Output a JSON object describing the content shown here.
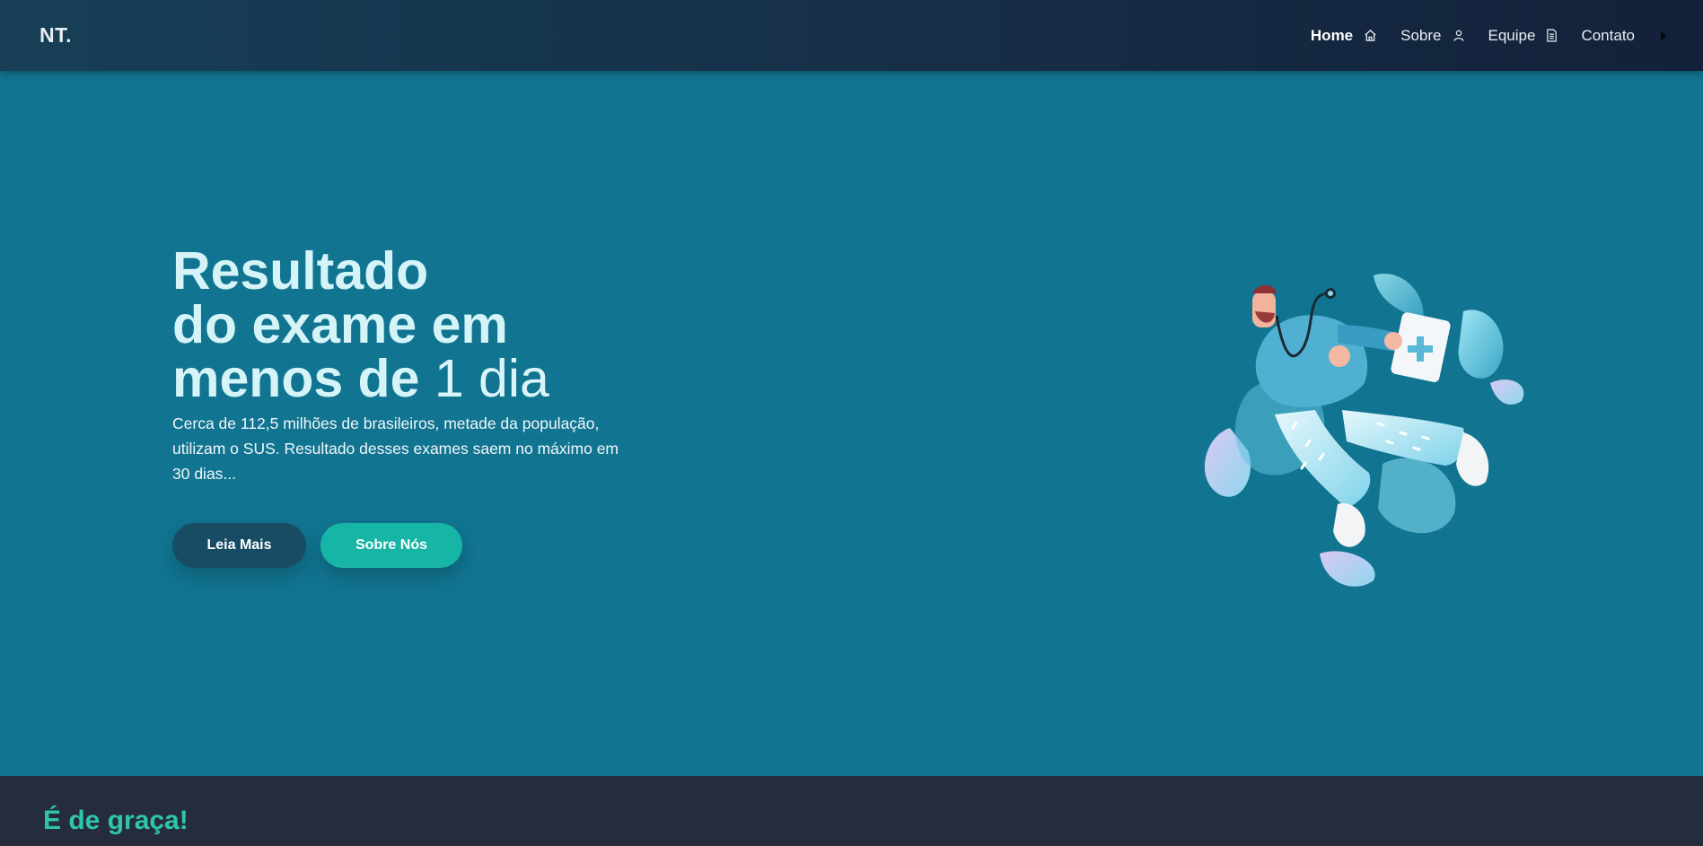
{
  "navbar": {
    "logo": "NT.",
    "items": [
      {
        "label": "Home",
        "icon": "home-icon",
        "active": true
      },
      {
        "label": "Sobre",
        "icon": "user-icon",
        "active": false
      },
      {
        "label": "Equipe",
        "icon": "document-icon",
        "active": false
      },
      {
        "label": "Contato",
        "icon": "play-icon",
        "active": false
      }
    ]
  },
  "hero": {
    "title_line1": "Resultado",
    "title_line2": "do exame em",
    "title_line3_bold": "menos de ",
    "title_line3_light": "1 dia",
    "description": "Cerca de 112,5 milhões de brasileiros, metade da população, utilizam o SUS. Resultado desses exames saem no máximo em 30 dias...",
    "primary_button": "Leia Mais",
    "secondary_button": "Sobre Nós",
    "illustration": "doctor-running-illustration"
  },
  "section_two": {
    "title": "É de graça!"
  },
  "colors": {
    "navbar_bg": "#162d45",
    "hero_bg": "#117490",
    "title_text": "#d4f4f8",
    "primary_button": "#174c64",
    "secondary_button": "#17b5a5",
    "section_two_bg": "#252d3c",
    "section_two_title": "#2ec6ab"
  }
}
